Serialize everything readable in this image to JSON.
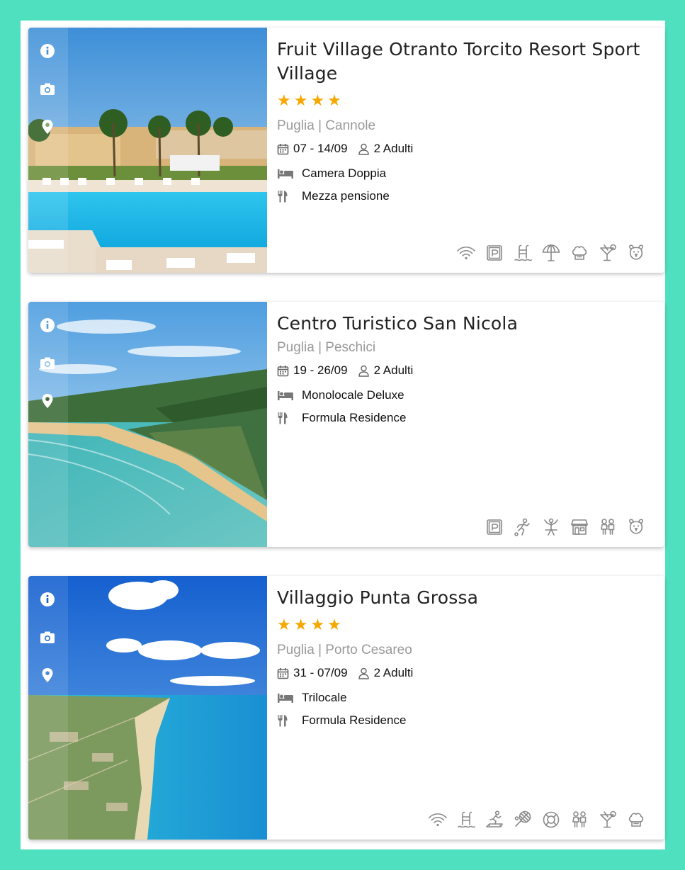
{
  "colors": {
    "background": "#4fe0c0",
    "star": "#f5a900",
    "muted": "#999999",
    "icon": "#8a8a8a"
  },
  "hotels": [
    {
      "name": "Fruit Village Otranto Torcito Resort Sport Village",
      "stars": "★★★★",
      "location": "Puglia | Cannole",
      "dates": "07 - 14/09",
      "guests": "2 Adulti",
      "room": "Camera Doppia",
      "board": "Mezza pensione",
      "amenities": [
        "wifi-icon",
        "parking-icon",
        "pool-icon",
        "beach-umbrella-icon",
        "restaurant-chef-icon",
        "cocktail-bar-icon",
        "pets-icon"
      ]
    },
    {
      "name": "Centro Turistico San Nicola",
      "stars": "",
      "location": "Puglia | Peschici",
      "dates": "19 - 26/09",
      "guests": "2 Adulti",
      "room": "Monolocale Deluxe",
      "board": "Formula Residence",
      "amenities": [
        "parking-icon",
        "sport-icon",
        "animation-icon",
        "market-icon",
        "kids-club-icon",
        "pets-icon"
      ]
    },
    {
      "name": "Villaggio Punta Grossa",
      "stars": "★★★★",
      "location": "Puglia | Porto Cesareo",
      "dates": "31 - 07/09",
      "guests": "2 Adulti",
      "room": "Trilocale",
      "board": "Formula Residence",
      "amenities": [
        "wifi-icon",
        "pool-icon",
        "fitness-icon",
        "tennis-icon",
        "lifeguard-icon",
        "kids-club-icon",
        "cocktail-bar-icon",
        "restaurant-chef-icon"
      ]
    }
  ]
}
